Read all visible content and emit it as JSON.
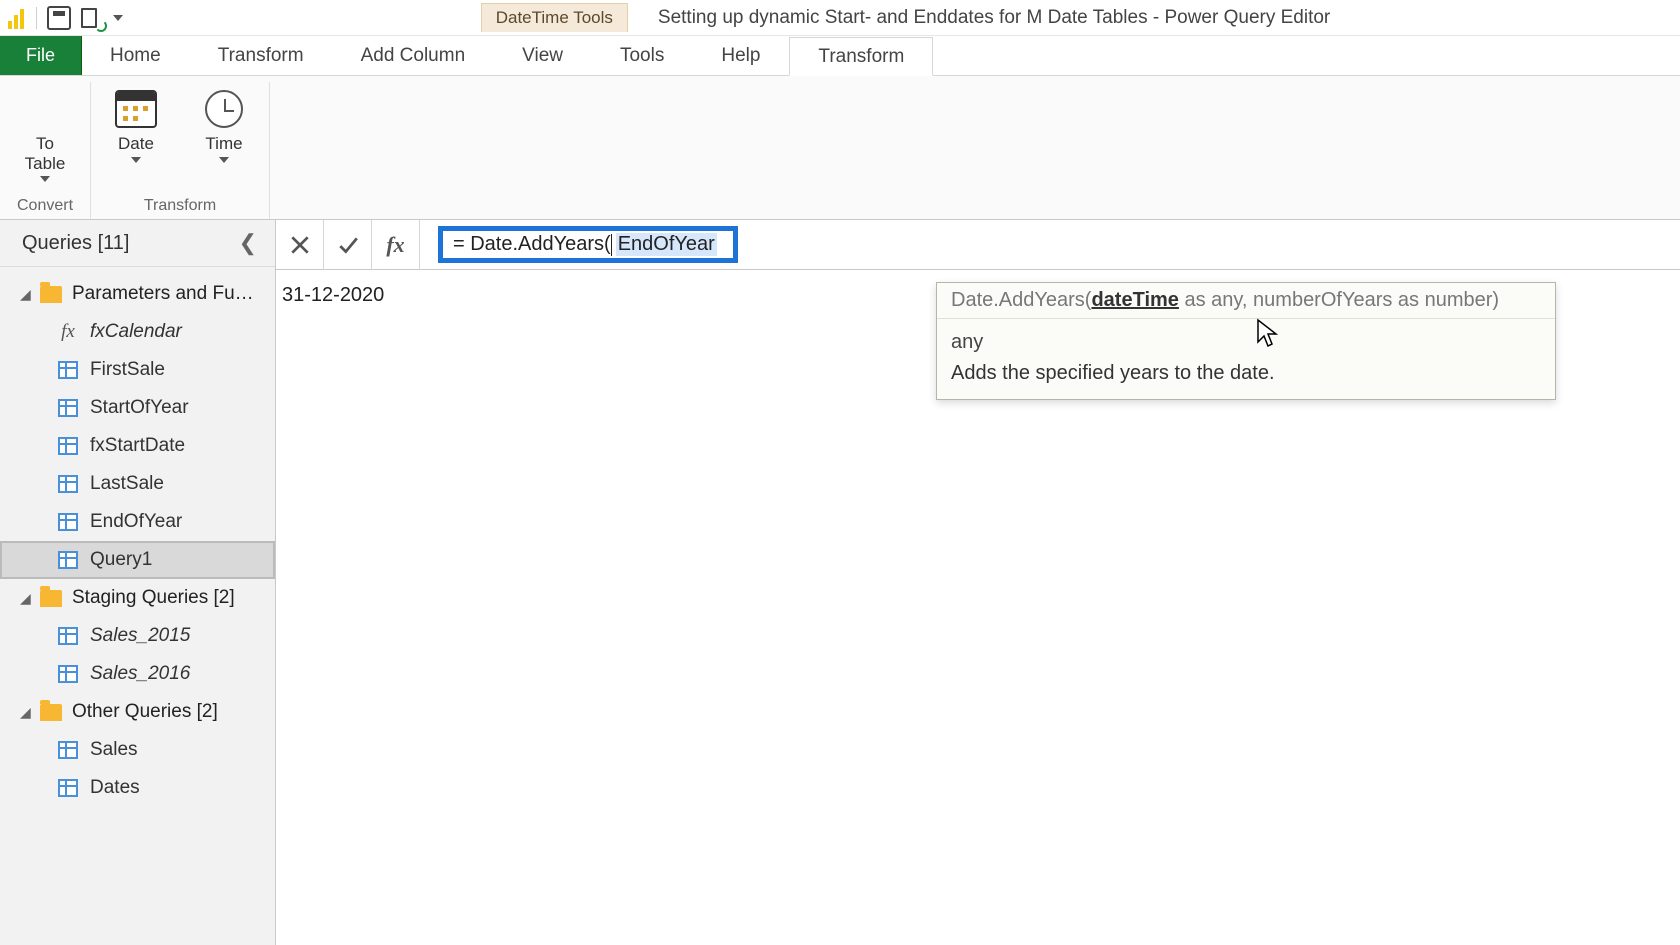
{
  "titlebar": {
    "context_tab": "DateTime Tools",
    "window_title": "Setting up dynamic Start- and Enddates for M Date Tables - Power Query Editor"
  },
  "tabs": {
    "file": "File",
    "home": "Home",
    "transform": "Transform",
    "add_column": "Add Column",
    "view": "View",
    "tools": "Tools",
    "help": "Help",
    "ctx_transform": "Transform"
  },
  "ribbon": {
    "convert": {
      "group_label": "Convert",
      "to_table": "To\nTable"
    },
    "transform": {
      "group_label": "Transform",
      "date": "Date",
      "time": "Time"
    }
  },
  "queries_pane": {
    "header": "Queries [11]",
    "groups": [
      {
        "label": "Parameters and Fu…",
        "items": [
          {
            "name": "fxCalendar",
            "type": "fx",
            "italic": true
          },
          {
            "name": "FirstSale",
            "type": "table"
          },
          {
            "name": "StartOfYear",
            "type": "table"
          },
          {
            "name": "fxStartDate",
            "type": "table"
          },
          {
            "name": "LastSale",
            "type": "table"
          },
          {
            "name": "EndOfYear",
            "type": "table"
          },
          {
            "name": "Query1",
            "type": "table",
            "selected": true
          }
        ]
      },
      {
        "label": "Staging Queries [2]",
        "items": [
          {
            "name": "Sales_2015",
            "type": "table",
            "italic": true
          },
          {
            "name": "Sales_2016",
            "type": "table",
            "italic": true
          }
        ]
      },
      {
        "label": "Other Queries [2]",
        "items": [
          {
            "name": "Sales",
            "type": "table"
          },
          {
            "name": "Dates",
            "type": "table"
          }
        ]
      }
    ]
  },
  "formula_bar": {
    "prefix": "= Date.AddYears(",
    "selected_arg": "EndOfYear"
  },
  "preview_value": "31-12-2020",
  "tooltip": {
    "sig_prefix": "Date.AddYears(",
    "sig_param_bold": "dateTime",
    "sig_rest": " as any, numberOfYears as number)",
    "type_line": "any",
    "description": "Adds the specified years to the date."
  }
}
